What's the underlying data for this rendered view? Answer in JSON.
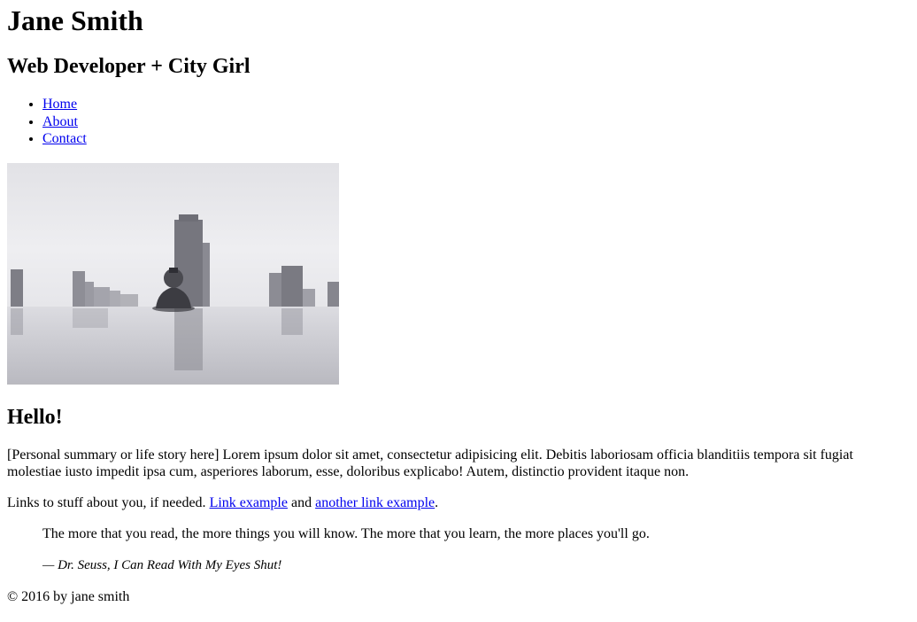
{
  "header": {
    "name": "Jane Smith",
    "tagline": "Web Developer + City Girl"
  },
  "nav": {
    "items": [
      {
        "label": "Home"
      },
      {
        "label": "About"
      },
      {
        "label": "Contact"
      }
    ]
  },
  "hero_image": {
    "description": "black-and-white photo of a woman in an infinity pool with city skyline"
  },
  "main": {
    "heading": "Hello!",
    "summary": "[Personal summary or life story here] Lorem ipsum dolor sit amet, consectetur adipisicing elit. Debitis laboriosam officia blanditiis tempora sit fugiat molestiae iusto impedit ipsa cum, asperiores laborum, esse, doloribus explicabo! Autem, distinctio provident itaque non.",
    "links_intro": "Links to stuff about you, if needed.",
    "link1": "Link example",
    "links_and": "and",
    "link2": "another link example",
    "links_end": "."
  },
  "quote": {
    "text": "The more that you read, the more things you will know. The more that you learn, the more places you'll go.",
    "source": "— Dr. Seuss, I Can Read With My Eyes Shut!"
  },
  "footer": {
    "text": "© 2016 by jane smith"
  },
  "colors": {
    "link": "#0000ee",
    "text": "#000000",
    "background": "#ffffff"
  }
}
